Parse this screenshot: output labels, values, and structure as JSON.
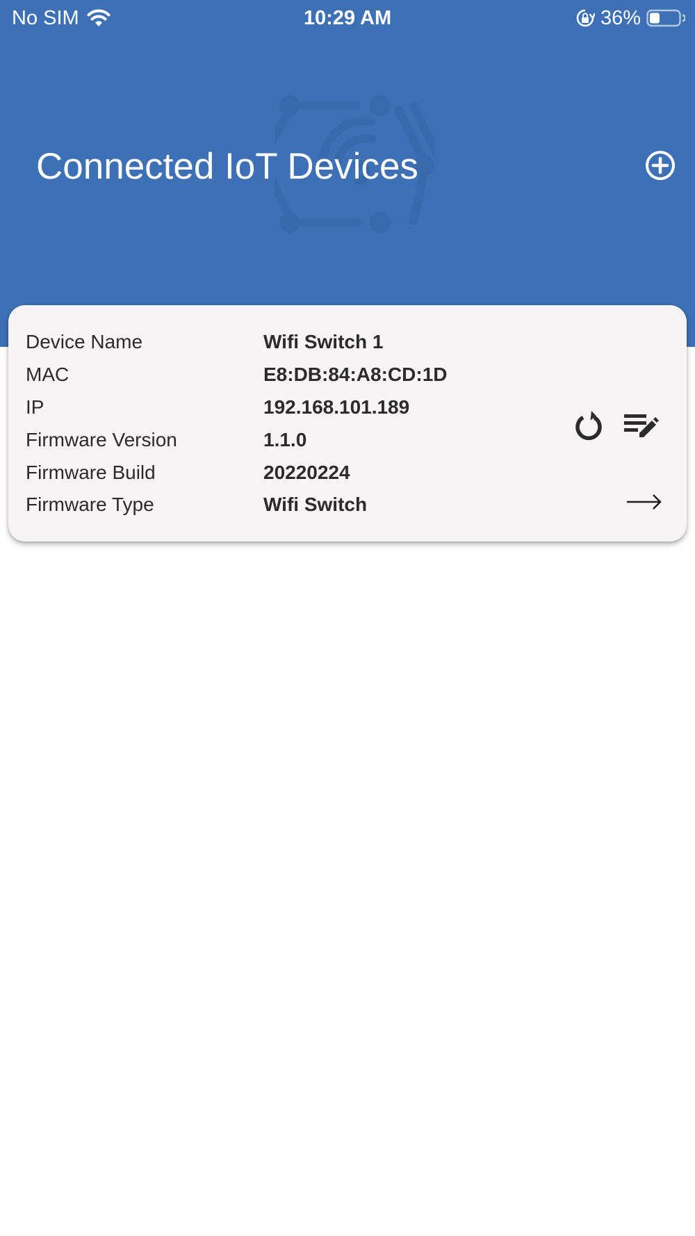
{
  "status_bar": {
    "carrier": "No SIM",
    "time": "10:29 AM",
    "battery_percent": "36%",
    "battery_level": 0.36,
    "icons": [
      "wifi-icon",
      "orientation-lock-icon",
      "battery-icon"
    ]
  },
  "header": {
    "title": "Connected IoT Devices",
    "background_color": "#3d70b5",
    "add_icon": "plus-circle-icon",
    "watermark_icon": "iot-network-icon"
  },
  "device_card": {
    "fields": [
      {
        "label": "Device Name",
        "value": "Wifi Switch 1"
      },
      {
        "label": "MAC",
        "value": "E8:DB:84:A8:CD:1D"
      },
      {
        "label": "IP",
        "value": "192.168.101.189"
      },
      {
        "label": "Firmware Version",
        "value": "1.1.0"
      },
      {
        "label": "Firmware Build",
        "value": "20220224"
      },
      {
        "label": "Firmware Type",
        "value": "Wifi Switch"
      }
    ],
    "actions": [
      "refresh-icon",
      "edit-list-icon",
      "arrow-right-icon"
    ],
    "background_color": "#f6f4f4"
  }
}
